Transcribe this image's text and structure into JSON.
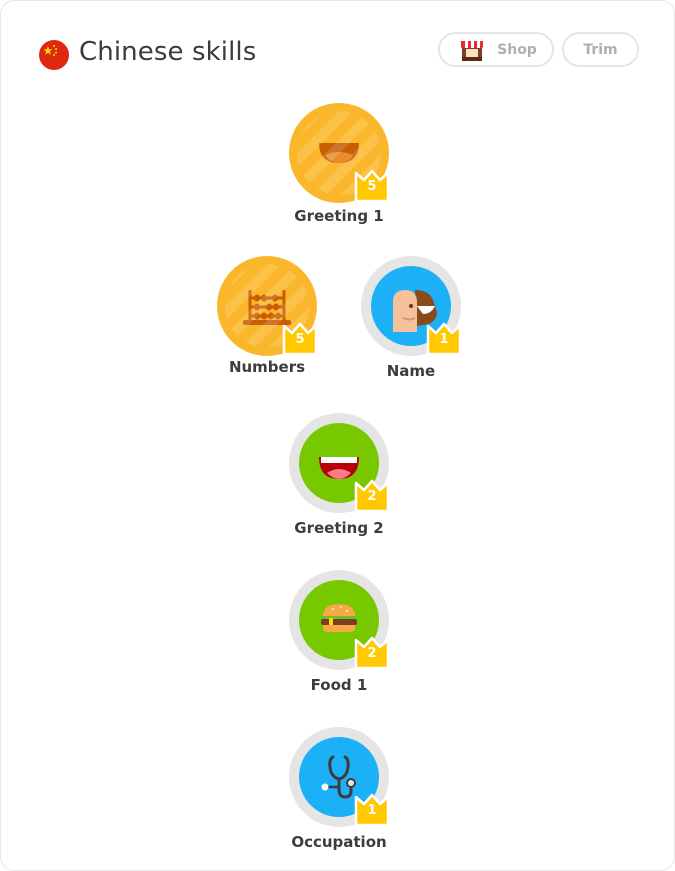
{
  "header": {
    "flag_icon": "china-flag-icon",
    "title": "Chinese skills",
    "shop_label": "Shop",
    "trim_label": "Trim"
  },
  "colors": {
    "gold": "#fbb72b",
    "green": "#78c800",
    "blue": "#1cb0f6",
    "crown": "#ffc800",
    "ring_grey": "#e5e5e5",
    "button_text": "#afafaf"
  },
  "skills": [
    {
      "name": "Greeting 1",
      "crowns": "5",
      "color": "gold",
      "icon": "smile-icon"
    },
    {
      "name": "Numbers",
      "crowns": "5",
      "color": "gold",
      "icon": "abacus-icon"
    },
    {
      "name": "Name",
      "crowns": "1",
      "color": "blue",
      "icon": "faces-icon"
    },
    {
      "name": "Greeting 2",
      "crowns": "2",
      "color": "green",
      "icon": "smile-icon"
    },
    {
      "name": "Food 1",
      "crowns": "2",
      "color": "green",
      "icon": "burger-icon"
    },
    {
      "name": "Occupation",
      "crowns": "1",
      "color": "blue",
      "icon": "stethoscope-icon"
    }
  ]
}
